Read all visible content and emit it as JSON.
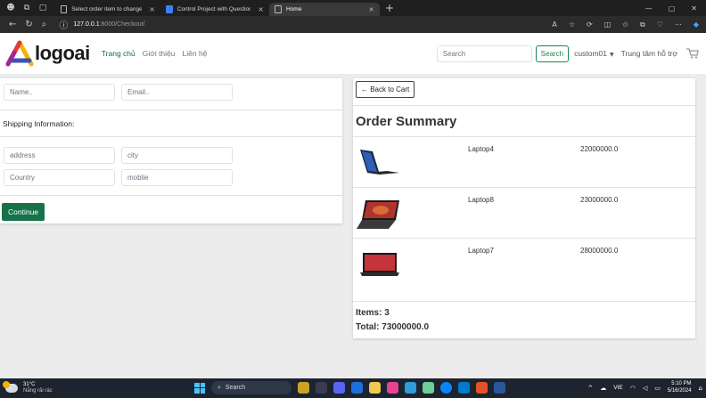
{
  "browser": {
    "tabs": [
      {
        "title": "Select order item to change | Dj",
        "active": false
      },
      {
        "title": "Control Project with Questions",
        "active": false
      },
      {
        "title": "Home",
        "active": true
      }
    ],
    "new_tab": "+",
    "url_host": "127.0.0.1",
    "url_path": ":8000/Checkout/"
  },
  "navbar": {
    "logo_text": "logoai",
    "links": [
      "Trang chủ",
      "Giới thiệu",
      "Liên hệ"
    ],
    "search_placeholder": "Search",
    "search_button": "Search",
    "user": "custom01",
    "support": "Trung tâm hỗ trợ"
  },
  "form": {
    "name_placeholder": "Name..",
    "email_placeholder": "Email..",
    "shipping_label": "Shipping Information:",
    "address_placeholder": "address",
    "city_placeholder": "city",
    "country_placeholder": "Country",
    "mobile_placeholder": "moblie",
    "continue_label": "Continue"
  },
  "summary": {
    "back_label": "← Back to Cart",
    "title": "Order Summary",
    "items": [
      {
        "name": "Laptop4",
        "price": "22000000.0"
      },
      {
        "name": "Laptop8",
        "price": "23000000.0"
      },
      {
        "name": "Laptop7",
        "price": "28000000.0"
      }
    ],
    "items_count": "Items: 3",
    "total": "Total: 73000000.0"
  },
  "taskbar": {
    "temperature": "31°C",
    "weather_desc": "Nắng rải rác",
    "search_label": "Search",
    "language": "VIE",
    "time": "5:10 PM",
    "date": "5/16/2024"
  },
  "colors": {
    "accent_green": "#157347",
    "link_active": "#0d6e3f"
  }
}
